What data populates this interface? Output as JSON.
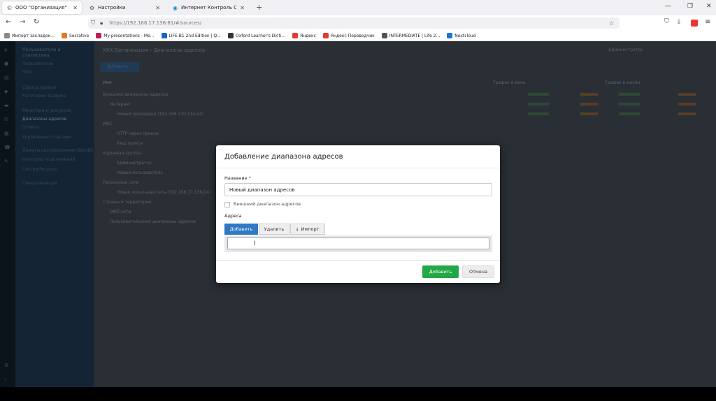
{
  "browser": {
    "tabs": [
      {
        "title": "ООО \"Организация\" › Диапаз",
        "icon": "c-logo-icon"
      },
      {
        "title": "Настройки",
        "icon": "gear-icon"
      },
      {
        "title": "Интернет Контроль Сервер - ",
        "icon": "ics-icon"
      }
    ],
    "url": "https://192.168.17.136:81/#/sources/",
    "bookmarks": [
      {
        "label": "Импорт закладок...",
        "color": "#888"
      },
      {
        "label": "Socrative",
        "color": "#e87722"
      },
      {
        "label": "My presentations - Me...",
        "color": "#c2185b"
      },
      {
        "label": "LIFE B1 2nd Edition | Q...",
        "color": "#1565c0"
      },
      {
        "label": "Oxford Learner's Dicti...",
        "color": "#333"
      },
      {
        "label": "Яндекс",
        "color": "#e53935"
      },
      {
        "label": "Яндекс Переводчик",
        "color": "#e53935"
      },
      {
        "label": "INTERMEDIATE | Life 2...",
        "color": "#555"
      },
      {
        "label": "Nextcloud",
        "color": "#1976d2"
      }
    ]
  },
  "sidebar": {
    "items": [
      {
        "label": "Пользователи и",
        "cls": "head"
      },
      {
        "label": "статистика",
        "cls": "head"
      },
      {
        "label": "Пользователи",
        "cls": ""
      },
      {
        "label": "Sites",
        "cls": ""
      },
      {
        "label": "Сбросы правил",
        "cls": ""
      },
      {
        "label": "Категории трафика",
        "cls": ""
      },
      {
        "label": "Мониторинг ресурсов",
        "cls": ""
      },
      {
        "label": "Диапазоны адресов",
        "cls": "act"
      },
      {
        "label": "Отчёты",
        "cls": ""
      },
      {
        "label": "Управление отчетами",
        "cls": ""
      },
      {
        "label": "Лимиты распределения (Bandb)",
        "cls": ""
      },
      {
        "label": "Контроль подключений",
        "cls": ""
      },
      {
        "label": "Сессии Ресурсы",
        "cls": ""
      },
      {
        "label": "Синхронизация",
        "cls": ""
      }
    ]
  },
  "main": {
    "breadcrumb": "XXX Организация › Диапазоны адресов",
    "user": "Администратор",
    "add_label": "Добавить",
    "col_name": "Имя",
    "col_day": "Трафик в день",
    "col_month": "Трафик в месяц",
    "rows": [
      "Внешние диапазоны адресов",
      "Интернет",
      "Новый провайдер (192.168.170.13x/24)",
      "ИМС",
      "HTTP через прокси",
      "Кеш прокси",
      "Корневая группа",
      "Администратор",
      "Новый пользователь",
      "Локальные сети",
      "Новая локальная сеть (192.168.17.136/24)",
      "Страны и территории",
      "DMZ сети",
      "Пользовательские диапазоны адресов"
    ]
  },
  "modal": {
    "title": "Добавление диапазона адресов",
    "name_label": "Название",
    "name_required": "*",
    "name_value": "Новый диапазон адресов",
    "external_label": "Внешний диапазон адресов",
    "addresses_label": "Адреса",
    "btn_add": "Добавить",
    "btn_delete": "Удалить",
    "btn_import": "Импорт",
    "submit_label": "Добавить",
    "cancel_label": "Отмена"
  },
  "colors": {
    "primary": "#2f78c4",
    "success": "#22a846"
  }
}
